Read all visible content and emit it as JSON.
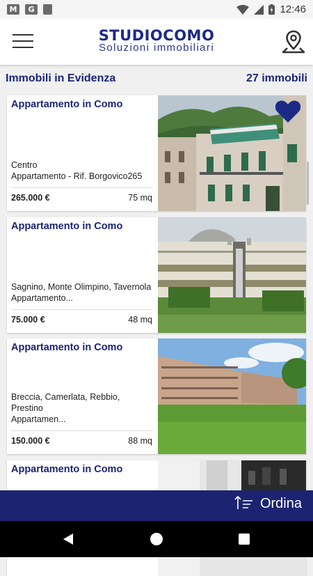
{
  "status_bar": {
    "time": "12:46",
    "left_icons": [
      "gmail-icon",
      "google-icon",
      "sd-card-icon"
    ],
    "right_icons": [
      "wifi-icon",
      "signal-icon",
      "battery-charging-icon"
    ]
  },
  "header": {
    "logo_main": "STUDIOCOMO",
    "logo_sub": "Soluzioni immobiliari",
    "menu_icon": "hamburger-menu-icon",
    "map_icon": "map-pin-icon"
  },
  "list": {
    "title": "Immobili in Evidenza",
    "count": "27 immobili"
  },
  "listings": [
    {
      "title": "Appartamento in Como",
      "desc_line1": "Centro",
      "desc_line2": "Appartamento - Rif. Borgovico265",
      "price": "265.000 €",
      "size": "75 mq",
      "favorite": true
    },
    {
      "title": "Appartamento in Como",
      "desc_line1": "Sagnino, Monte Olimpino, Tavernola",
      "desc_line2": "Appartamento...",
      "price": "75.000 €",
      "size": "48 mq",
      "favorite": false
    },
    {
      "title": "Appartamento in Como",
      "desc_line1": "Breccia, Camerlata, Rebbio, Prestino",
      "desc_line2": "Appartamen...",
      "price": "150.000 €",
      "size": "88 mq",
      "favorite": false
    },
    {
      "title": "Appartamento in Como",
      "desc_line1": "",
      "desc_line2": "",
      "price": "",
      "size": "",
      "favorite": false
    }
  ],
  "sort": {
    "label": "Ordina",
    "icon": "sort-icon"
  },
  "colors": {
    "brand_navy": "#1c2472",
    "favorite": "#1c2a85"
  }
}
